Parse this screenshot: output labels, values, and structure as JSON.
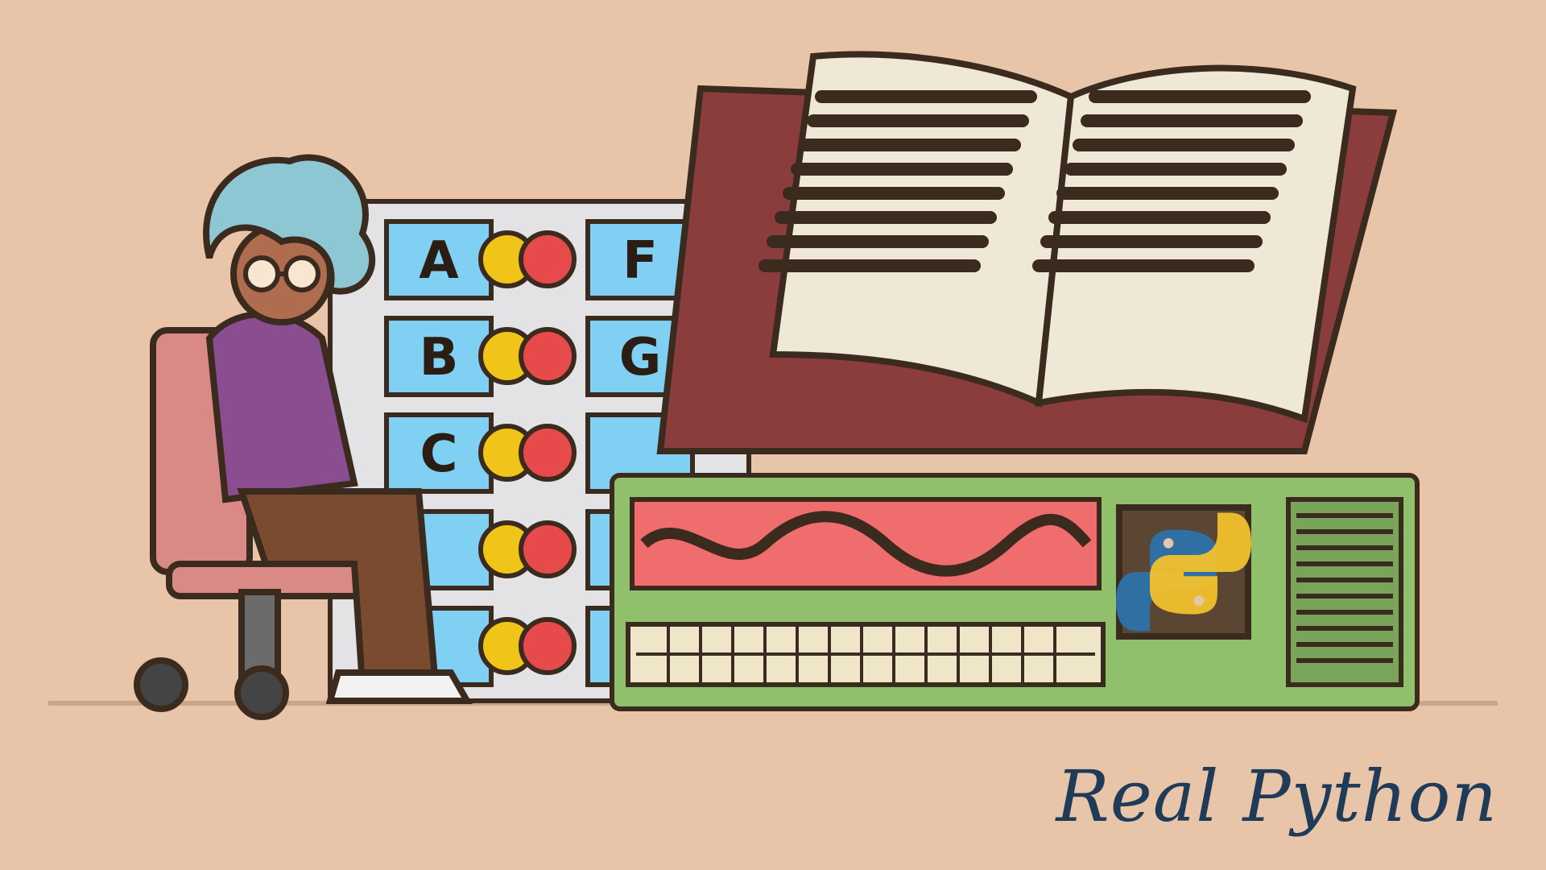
{
  "scene": {
    "background_color": "#e8c5a8",
    "drawer_letters_left": [
      "A",
      "B",
      "C"
    ],
    "drawer_letters_right": [
      "F",
      "G"
    ],
    "icon": "python-logo-icon"
  },
  "branding": {
    "wordmark": "Real Python",
    "color": "#1f3b57"
  }
}
